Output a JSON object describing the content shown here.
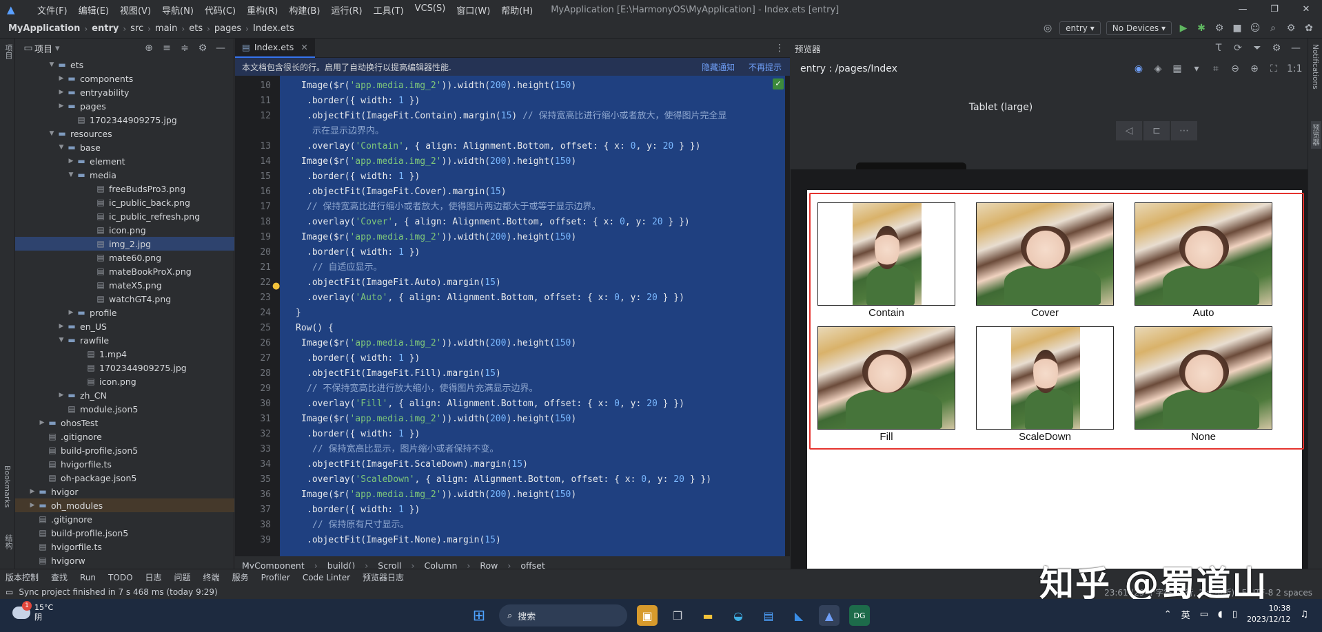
{
  "titlebar": {
    "menus": [
      "文件(F)",
      "编辑(E)",
      "视图(V)",
      "导航(N)",
      "代码(C)",
      "重构(R)",
      "构建(B)",
      "运行(R)",
      "工具(T)",
      "VCS(S)",
      "窗口(W)",
      "帮助(H)"
    ],
    "title": "MyApplication [E:\\HarmonyOS\\MyApplication] - Index.ets [entry]"
  },
  "navbar": {
    "crumbs": [
      "MyApplication",
      "entry",
      "src",
      "main",
      "ets",
      "pages",
      "Index.ets"
    ],
    "module": "entry",
    "device": "No Devices"
  },
  "leftstrip": {
    "project": "项目",
    "bookmarks": "Bookmarks",
    "structure": "结构"
  },
  "project": {
    "header": "项目",
    "tree": [
      {
        "label": "ets",
        "type": "folder",
        "depth": 3,
        "open": true
      },
      {
        "label": "components",
        "type": "folder",
        "depth": 4
      },
      {
        "label": "entryability",
        "type": "folder",
        "depth": 4
      },
      {
        "label": "pages",
        "type": "folder",
        "depth": 4
      },
      {
        "label": "1702344909275.jpg",
        "type": "file",
        "depth": 5
      },
      {
        "label": "resources",
        "type": "folder",
        "depth": 3,
        "open": true
      },
      {
        "label": "base",
        "type": "folder",
        "depth": 4,
        "open": true
      },
      {
        "label": "element",
        "type": "folder",
        "depth": 5
      },
      {
        "label": "media",
        "type": "folder",
        "depth": 5,
        "open": true
      },
      {
        "label": "freeBudsPro3.png",
        "type": "file",
        "depth": 7
      },
      {
        "label": "ic_public_back.png",
        "type": "file",
        "depth": 7
      },
      {
        "label": "ic_public_refresh.png",
        "type": "file",
        "depth": 7
      },
      {
        "label": "icon.png",
        "type": "file",
        "depth": 7
      },
      {
        "label": "img_2.jpg",
        "type": "file",
        "depth": 7,
        "selected": true
      },
      {
        "label": "mate60.png",
        "type": "file",
        "depth": 7
      },
      {
        "label": "mateBookProX.png",
        "type": "file",
        "depth": 7
      },
      {
        "label": "mateX5.png",
        "type": "file",
        "depth": 7
      },
      {
        "label": "watchGT4.png",
        "type": "file",
        "depth": 7
      },
      {
        "label": "profile",
        "type": "folder",
        "depth": 5
      },
      {
        "label": "en_US",
        "type": "folder",
        "depth": 4
      },
      {
        "label": "rawfile",
        "type": "folder",
        "depth": 4,
        "open": true
      },
      {
        "label": "1.mp4",
        "type": "file",
        "depth": 6
      },
      {
        "label": "1702344909275.jpg",
        "type": "file",
        "depth": 6
      },
      {
        "label": "icon.png",
        "type": "file",
        "depth": 6
      },
      {
        "label": "zh_CN",
        "type": "folder",
        "depth": 4
      },
      {
        "label": "module.json5",
        "type": "file",
        "depth": 4
      },
      {
        "label": "ohosTest",
        "type": "folder",
        "depth": 2
      },
      {
        "label": ".gitignore",
        "type": "file",
        "depth": 2
      },
      {
        "label": "build-profile.json5",
        "type": "file",
        "depth": 2
      },
      {
        "label": "hvigorfile.ts",
        "type": "file",
        "depth": 2
      },
      {
        "label": "oh-package.json5",
        "type": "file",
        "depth": 2
      },
      {
        "label": "hvigor",
        "type": "folder",
        "depth": 1
      },
      {
        "label": "oh_modules",
        "type": "folder",
        "depth": 1,
        "highlight": true
      },
      {
        "label": ".gitignore",
        "type": "file",
        "depth": 1
      },
      {
        "label": "build-profile.json5",
        "type": "file",
        "depth": 1
      },
      {
        "label": "hvigorfile.ts",
        "type": "file",
        "depth": 1
      },
      {
        "label": "hvigorw",
        "type": "file",
        "depth": 1
      }
    ]
  },
  "editor": {
    "tab": "Index.ets",
    "notice": "本文档包含很长的行。启用了自动换行以提高编辑器性能.",
    "notice_actions": [
      "隐藏通知",
      "不再提示"
    ],
    "lines": [
      {
        "n": "10",
        "indent": 5,
        "text": "Image($r('app.media.img_2')).width(200).height(150)"
      },
      {
        "n": "11",
        "indent": 6,
        "text": ".border({ width: 1 })"
      },
      {
        "n": "12",
        "indent": 6,
        "text": ".objectFit(ImageFit.Contain).margin(15) // 保持宽高比进行缩小或者放大，使得图片完全显"
      },
      {
        "n": "",
        "indent": 7,
        "text": "示在显示边界内。"
      },
      {
        "n": "13",
        "indent": 6,
        "text": ".overlay('Contain', { align: Alignment.Bottom, offset: { x: 0, y: 20 } })"
      },
      {
        "n": "14",
        "indent": 5,
        "text": "Image($r('app.media.img_2')).width(200).height(150)"
      },
      {
        "n": "15",
        "indent": 6,
        "text": ".border({ width: 1 })"
      },
      {
        "n": "16",
        "indent": 6,
        "text": ".objectFit(ImageFit.Cover).margin(15)"
      },
      {
        "n": "17",
        "indent": 6,
        "text": "// 保持宽高比进行缩小或者放大，使得图片两边都大于或等于显示边界。"
      },
      {
        "n": "18",
        "indent": 6,
        "text": ".overlay('Cover', { align: Alignment.Bottom, offset: { x: 0, y: 20 } })"
      },
      {
        "n": "19",
        "indent": 5,
        "text": "Image($r('app.media.img_2')).width(200).height(150)"
      },
      {
        "n": "20",
        "indent": 6,
        "text": ".border({ width: 1 })"
      },
      {
        "n": "21",
        "indent": 7,
        "text": "// 自适应显示。"
      },
      {
        "n": "22",
        "indent": 6,
        "text": ".objectFit(ImageFit.Auto).margin(15)"
      },
      {
        "n": "23",
        "indent": 6,
        "text": ".overlay('Auto', { align: Alignment.Bottom, offset: { x: 0, y: 20 } })"
      },
      {
        "n": "24",
        "indent": 4,
        "text": "}"
      },
      {
        "n": "25",
        "indent": 4,
        "text": "Row() {"
      },
      {
        "n": "26",
        "indent": 5,
        "text": "Image($r('app.media.img_2')).width(200).height(150)"
      },
      {
        "n": "27",
        "indent": 6,
        "text": ".border({ width: 1 })"
      },
      {
        "n": "28",
        "indent": 6,
        "text": ".objectFit(ImageFit.Fill).margin(15)"
      },
      {
        "n": "29",
        "indent": 6,
        "text": "// 不保持宽高比进行放大缩小，使得图片充满显示边界。"
      },
      {
        "n": "30",
        "indent": 6,
        "text": ".overlay('Fill', { align: Alignment.Bottom, offset: { x: 0, y: 20 } })"
      },
      {
        "n": "31",
        "indent": 5,
        "text": "Image($r('app.media.img_2')).width(200).height(150)"
      },
      {
        "n": "32",
        "indent": 6,
        "text": ".border({ width: 1 })"
      },
      {
        "n": "33",
        "indent": 7,
        "text": "// 保持宽高比显示，图片缩小或者保持不变。"
      },
      {
        "n": "34",
        "indent": 6,
        "text": ".objectFit(ImageFit.ScaleDown).margin(15)"
      },
      {
        "n": "35",
        "indent": 6,
        "text": ".overlay('ScaleDown', { align: Alignment.Bottom, offset: { x: 0, y: 20 } })"
      },
      {
        "n": "36",
        "indent": 5,
        "text": "Image($r('app.media.img_2')).width(200).height(150)"
      },
      {
        "n": "37",
        "indent": 6,
        "text": ".border({ width: 1 })"
      },
      {
        "n": "38",
        "indent": 7,
        "text": "// 保持原有尺寸显示。"
      },
      {
        "n": "39",
        "indent": 6,
        "text": ".objectFit(ImageFit.None).margin(15)"
      }
    ],
    "breadcrumb": [
      "MyComponent",
      "build()",
      "Scroll",
      "Column",
      "Row",
      "offset"
    ]
  },
  "preview": {
    "header": "预览器",
    "path": "entry : /pages/Index",
    "device_name": "Tablet (large)",
    "captions": [
      "Contain",
      "Cover",
      "Auto",
      "Fill",
      "ScaleDown",
      "None"
    ]
  },
  "rightstrip": {
    "notifications": "Notifications",
    "previewer": "预览器"
  },
  "toolwindows": [
    "版本控制",
    "查找",
    "Run",
    "TODO",
    "日志",
    "问题",
    "终端",
    "服务",
    "Profiler",
    "Code Linter",
    "预览器日志"
  ],
  "status": {
    "message": "Sync project finished in 7 s 468 ms (today 9:29)",
    "right": "23:61 (29 个字符, 4 行, 1 个中断)   LF   UTF-8   2 spaces"
  },
  "watermark": "知乎 @蜀道山",
  "taskbar": {
    "weather_temp": "15°C",
    "weather_desc": "阴",
    "weather_badge": "1",
    "search": "搜索",
    "ime": "英",
    "time": "10:38",
    "date": "2023/12/12"
  },
  "colors": {
    "accent": "#3574f0",
    "selection": "#1f4080",
    "redbox": "#e5322d"
  }
}
